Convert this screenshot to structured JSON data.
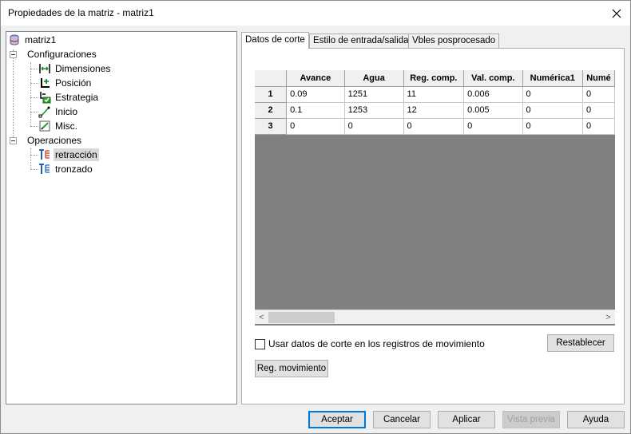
{
  "window": {
    "title": "Propiedades de la matriz - matriz1"
  },
  "tree": {
    "root": "matriz1",
    "configuraciones": "Configuraciones",
    "dimensiones": "Dimensiones",
    "posicion": "Posición",
    "estrategia": "Estrategia",
    "inicio": "Inicio",
    "misc": "Misc.",
    "operaciones": "Operaciones",
    "retraccion": "retracción",
    "tronzado": "tronzado"
  },
  "tabs": [
    "Datos de corte",
    "Estilo de entrada/salida",
    "Vbles posprocesado"
  ],
  "table": {
    "columns": [
      "Avance",
      "Agua",
      "Reg. comp.",
      "Val. comp.",
      "Numérica1",
      "Numé"
    ],
    "rows": [
      {
        "num": "1",
        "cells": [
          "0.09",
          "1251",
          "11",
          "0.006",
          "0",
          "0"
        ]
      },
      {
        "num": "2",
        "cells": [
          "0.1",
          "1253",
          "12",
          "0.005",
          "0",
          "0"
        ]
      },
      {
        "num": "3",
        "cells": [
          "0",
          "0",
          "0",
          "0",
          "0",
          "0"
        ]
      }
    ]
  },
  "scroll": {
    "left": "<",
    "right": ">"
  },
  "options": {
    "use_cut_data_label": "Usar datos de corte en los registros de movimiento",
    "restablecer": "Restablecer",
    "reg_movimiento": "Reg. movimiento"
  },
  "footer": {
    "aceptar": "Aceptar",
    "cancelar": "Cancelar",
    "aplicar": "Aplicar",
    "vista_previa": "Vista previa",
    "ayuda": "Ayuda"
  },
  "colors": {
    "accent": "#0078d7",
    "grid_bg": "#808080"
  }
}
